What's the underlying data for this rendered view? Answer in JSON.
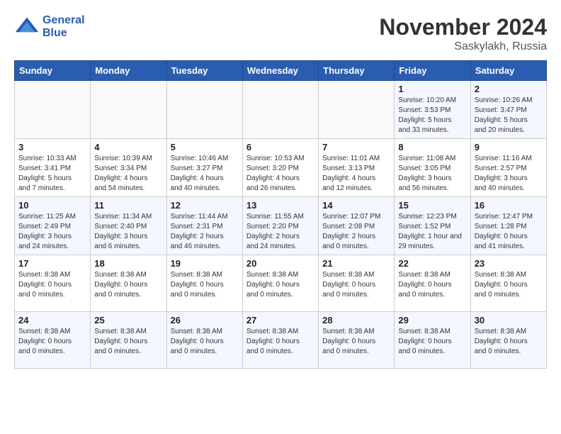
{
  "header": {
    "logo_line1": "General",
    "logo_line2": "Blue",
    "month": "November 2024",
    "location": "Saskylakh, Russia"
  },
  "weekdays": [
    "Sunday",
    "Monday",
    "Tuesday",
    "Wednesday",
    "Thursday",
    "Friday",
    "Saturday"
  ],
  "weeks": [
    [
      {
        "day": "",
        "info": ""
      },
      {
        "day": "",
        "info": ""
      },
      {
        "day": "",
        "info": ""
      },
      {
        "day": "",
        "info": ""
      },
      {
        "day": "",
        "info": ""
      },
      {
        "day": "1",
        "info": "Sunrise: 10:20 AM\nSunset: 3:53 PM\nDaylight: 5 hours\nand 33 minutes."
      },
      {
        "day": "2",
        "info": "Sunrise: 10:26 AM\nSunset: 3:47 PM\nDaylight: 5 hours\nand 20 minutes."
      }
    ],
    [
      {
        "day": "3",
        "info": "Sunrise: 10:33 AM\nSunset: 3:41 PM\nDaylight: 5 hours\nand 7 minutes."
      },
      {
        "day": "4",
        "info": "Sunrise: 10:39 AM\nSunset: 3:34 PM\nDaylight: 4 hours\nand 54 minutes."
      },
      {
        "day": "5",
        "info": "Sunrise: 10:46 AM\nSunset: 3:27 PM\nDaylight: 4 hours\nand 40 minutes."
      },
      {
        "day": "6",
        "info": "Sunrise: 10:53 AM\nSunset: 3:20 PM\nDaylight: 4 hours\nand 26 minutes."
      },
      {
        "day": "7",
        "info": "Sunrise: 11:01 AM\nSunset: 3:13 PM\nDaylight: 4 hours\nand 12 minutes."
      },
      {
        "day": "8",
        "info": "Sunrise: 11:08 AM\nSunset: 3:05 PM\nDaylight: 3 hours\nand 56 minutes."
      },
      {
        "day": "9",
        "info": "Sunrise: 11:16 AM\nSunset: 2:57 PM\nDaylight: 3 hours\nand 40 minutes."
      }
    ],
    [
      {
        "day": "10",
        "info": "Sunrise: 11:25 AM\nSunset: 2:49 PM\nDaylight: 3 hours\nand 24 minutes."
      },
      {
        "day": "11",
        "info": "Sunrise: 11:34 AM\nSunset: 2:40 PM\nDaylight: 3 hours\nand 6 minutes."
      },
      {
        "day": "12",
        "info": "Sunrise: 11:44 AM\nSunset: 2:31 PM\nDaylight: 2 hours\nand 46 minutes."
      },
      {
        "day": "13",
        "info": "Sunrise: 11:55 AM\nSunset: 2:20 PM\nDaylight: 2 hours\nand 24 minutes."
      },
      {
        "day": "14",
        "info": "Sunrise: 12:07 PM\nSunset: 2:08 PM\nDaylight: 2 hours\nand 0 minutes."
      },
      {
        "day": "15",
        "info": "Sunrise: 12:23 PM\nSunset: 1:52 PM\nDaylight: 1 hour and\n29 minutes."
      },
      {
        "day": "16",
        "info": "Sunrise: 12:47 PM\nSunset: 1:28 PM\nDaylight: 0 hours\nand 41 minutes."
      }
    ],
    [
      {
        "day": "17",
        "info": "Sunset: 8:38 AM\nDaylight: 0 hours\nand 0 minutes."
      },
      {
        "day": "18",
        "info": "Sunset: 8:38 AM\nDaylight: 0 hours\nand 0 minutes."
      },
      {
        "day": "19",
        "info": "Sunset: 8:38 AM\nDaylight: 0 hours\nand 0 minutes."
      },
      {
        "day": "20",
        "info": "Sunset: 8:38 AM\nDaylight: 0 hours\nand 0 minutes."
      },
      {
        "day": "21",
        "info": "Sunset: 8:38 AM\nDaylight: 0 hours\nand 0 minutes."
      },
      {
        "day": "22",
        "info": "Sunset: 8:38 AM\nDaylight: 0 hours\nand 0 minutes."
      },
      {
        "day": "23",
        "info": "Sunset: 8:38 AM\nDaylight: 0 hours\nand 0 minutes."
      }
    ],
    [
      {
        "day": "24",
        "info": "Sunset: 8:38 AM\nDaylight: 0 hours\nand 0 minutes."
      },
      {
        "day": "25",
        "info": "Sunset: 8:38 AM\nDaylight: 0 hours\nand 0 minutes."
      },
      {
        "day": "26",
        "info": "Sunset: 8:38 AM\nDaylight: 0 hours\nand 0 minutes."
      },
      {
        "day": "27",
        "info": "Sunset: 8:38 AM\nDaylight: 0 hours\nand 0 minutes."
      },
      {
        "day": "28",
        "info": "Sunset: 8:38 AM\nDaylight: 0 hours\nand 0 minutes."
      },
      {
        "day": "29",
        "info": "Sunset: 8:38 AM\nDaylight: 0 hours\nand 0 minutes."
      },
      {
        "day": "30",
        "info": "Sunset: 8:38 AM\nDaylight: 0 hours\nand 0 minutes."
      }
    ]
  ]
}
